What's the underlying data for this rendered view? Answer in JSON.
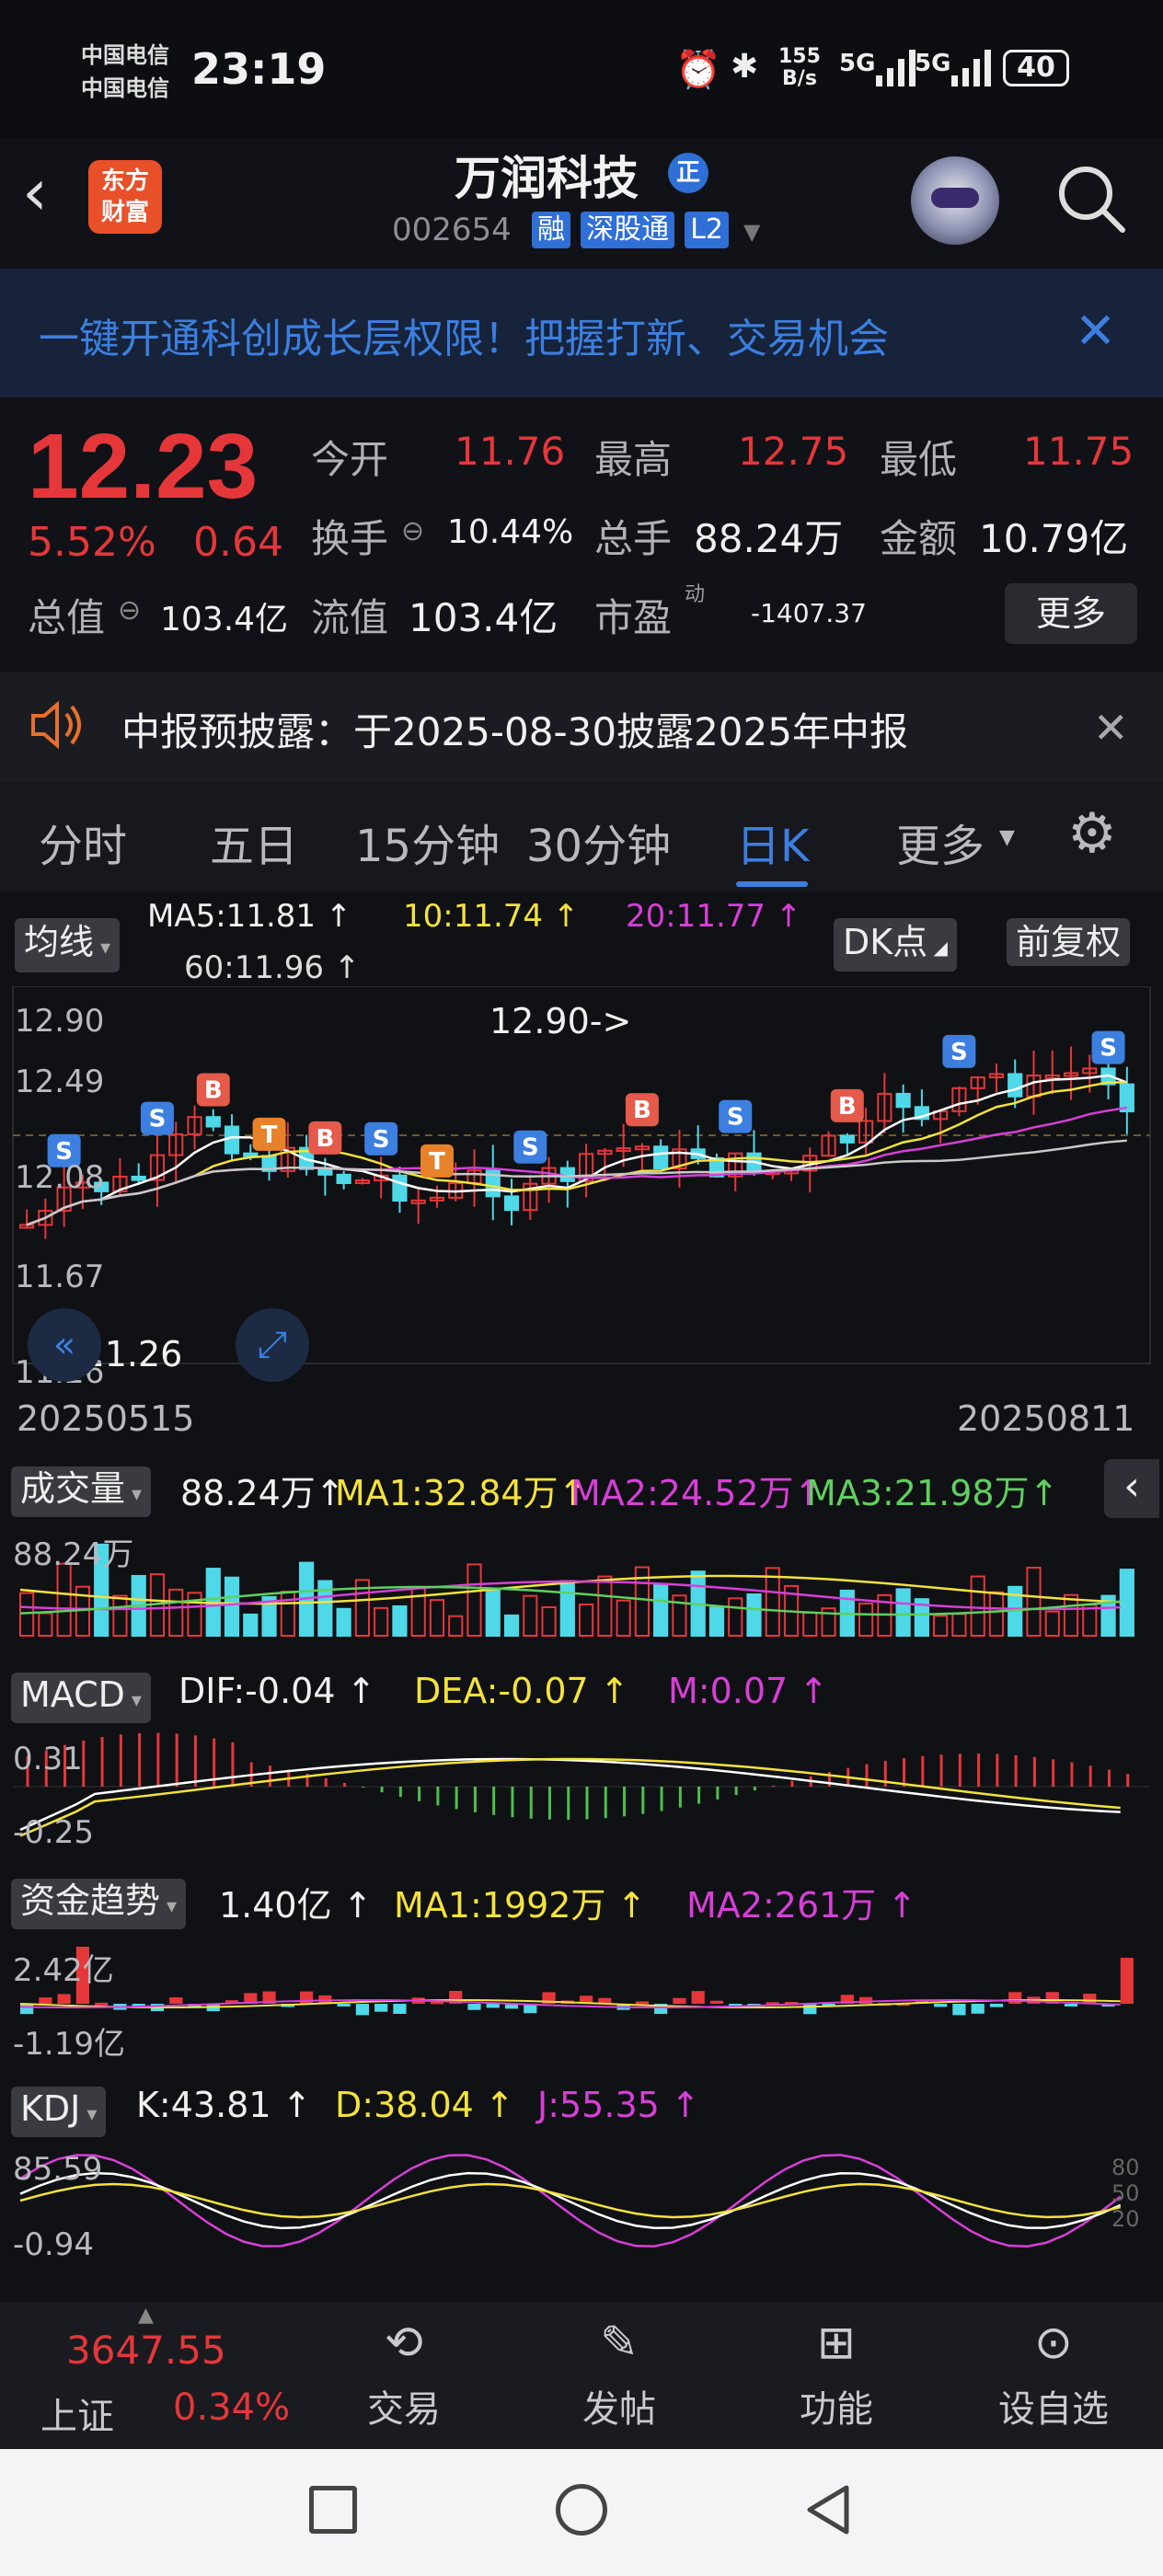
{
  "status_bar": {
    "carrier1": "中国电信",
    "carrier2": "中国电信",
    "time": "23:19",
    "net_speed_value": "155",
    "net_speed_unit": "B/s",
    "signal1": "5G",
    "signal2": "5G",
    "battery": "40"
  },
  "header": {
    "app_logo_line1": "东方",
    "app_logo_line2": "财富",
    "stock_name": "万润科技",
    "badge": "正",
    "stock_code": "002654",
    "tags": [
      "融",
      "深股通",
      "L2"
    ]
  },
  "banner": {
    "text": "一键开通科创成长层权限！把握打新、交易机会"
  },
  "quote": {
    "price": "12.23",
    "change_pct": "5.52%",
    "change_amt": "0.64",
    "open_label": "今开",
    "open_value": "11.76",
    "high_label": "最高",
    "high_value": "12.75",
    "low_label": "最低",
    "low_value": "11.75",
    "turnover_label": "换手",
    "turnover_value": "10.44%",
    "volume_label": "总手",
    "volume_value": "88.24万",
    "amount_label": "金额",
    "amount_value": "10.79亿",
    "mktcap_label": "总值",
    "mktcap_value": "103.4亿",
    "float_label": "流值",
    "float_value": "103.4亿",
    "pe_label": "市盈",
    "pe_sup": "动",
    "pe_value": "-1407.37",
    "more_button": "更多"
  },
  "notice": {
    "text": "中报预披露：于2025-08-30披露2025年中报"
  },
  "tabs": [
    "分时",
    "五日",
    "15分钟",
    "30分钟",
    "日K",
    "更多"
  ],
  "active_tab": "日K",
  "kline": {
    "ma_selector": "均线",
    "ma5": "MA5:11.81",
    "ma10": "10:11.74",
    "ma20": "20:11.77",
    "ma60": "60:11.96",
    "dk_button": "DK点",
    "adjust_button": "前复权",
    "y_labels": [
      "12.90",
      "12.49",
      "12.08",
      "11.67",
      "11.26"
    ],
    "high_annotation": "12.90->",
    "low_annotation": "<-11.26",
    "date_start": "20250515",
    "date_end": "20250811",
    "colors": {
      "up": "#e5373a",
      "down": "#4fd8e8",
      "ma5": "#ffffff",
      "ma10": "#f4e23c",
      "ma20": "#d83fd8",
      "ma60": "#c8c8c8"
    }
  },
  "volume": {
    "selector": "成交量",
    "value": "88.24万",
    "ma1": "MA1:32.84万",
    "ma2": "MA2:24.52万",
    "ma3": "MA3:21.98万",
    "max_label": "88.24万"
  },
  "macd": {
    "selector": "MACD",
    "dif": "DIF:-0.04",
    "dea": "DEA:-0.07",
    "m": "M:0.07",
    "top_label": "0.31",
    "bottom_label": "-0.25"
  },
  "fund": {
    "selector": "资金趋势",
    "value": "1.40亿",
    "ma1": "MA1:1992万",
    "ma2": "MA2:261万",
    "top_label": "2.42亿",
    "bottom_label": "-1.19亿"
  },
  "kdj": {
    "selector": "KDJ",
    "k": "K:43.81",
    "d": "D:38.04",
    "j": "J:55.35",
    "top_label": "85.59",
    "bottom_label": "-0.94",
    "right_top": "80",
    "right_mid": "50",
    "right_low": "20"
  },
  "bottom_nav": {
    "index_value": "3647.55",
    "index_name": "上证",
    "index_change": "0.34%",
    "items": [
      "交易",
      "发帖",
      "功能",
      "设自选"
    ]
  },
  "chart_data": {
    "type": "candlestick",
    "title": "",
    "x_range": [
      "20250515",
      "20250811"
    ],
    "ylim": [
      11.26,
      12.9
    ],
    "last_close": 12.23,
    "high": 12.9,
    "low": 11.26
  }
}
